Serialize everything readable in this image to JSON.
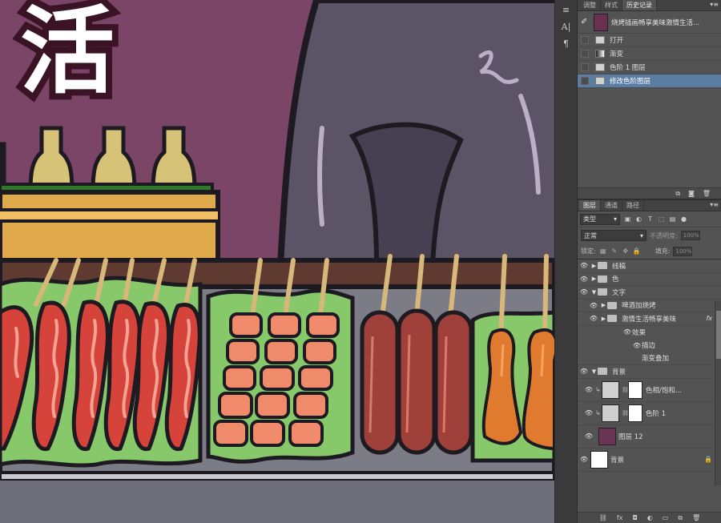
{
  "canvas": {
    "headline_char": "活"
  },
  "mini_strip": {
    "text_tool_glyph": "A|",
    "paragraph_glyph": "¶"
  },
  "history_panel": {
    "tabs": [
      "调整",
      "样式",
      "历史记录"
    ],
    "active_tab": "历史记录",
    "snapshot_title": "烧烤插画畅享美味激情生活...",
    "steps": [
      "打开",
      "渐变",
      "色阶 1 图层",
      "修改色阶图层"
    ],
    "selected_step": "修改色阶图层"
  },
  "layers_panel": {
    "tabs": [
      "图层",
      "通道",
      "路径"
    ],
    "active_tab": "图层",
    "filter_kind": "类型",
    "blend_mode": "正常",
    "opacity_label": "不透明度:",
    "opacity_value": "100%",
    "lock_label": "锁定:",
    "fill_label": "填充:",
    "fill_value": "100%",
    "layers": [
      {
        "name": "线稿",
        "type": "group",
        "indent": 0,
        "expanded": false
      },
      {
        "name": "色",
        "type": "group",
        "indent": 0,
        "expanded": false
      },
      {
        "name": "文字",
        "type": "group",
        "indent": 0,
        "expanded": true
      },
      {
        "name": "啤酒加烧烤",
        "type": "group",
        "indent": 1,
        "expanded": false
      },
      {
        "name": "激情生活畅享美味",
        "type": "group",
        "indent": 1,
        "expanded": false,
        "fx": "fx"
      },
      {
        "name": "效果",
        "type": "effect-header",
        "indent": 2
      },
      {
        "name": "描边",
        "type": "effect",
        "indent": 3
      },
      {
        "name": "渐变叠加",
        "type": "effect",
        "indent": 3
      },
      {
        "name": "背景",
        "type": "group",
        "indent": 0,
        "expanded": true
      },
      {
        "name": "色相/饱和...",
        "type": "adjustment",
        "indent": 1
      },
      {
        "name": "色阶 1",
        "type": "adjustment",
        "indent": 1
      },
      {
        "name": "图层 12",
        "type": "pixel",
        "indent": 1
      },
      {
        "name": "背景",
        "type": "background",
        "indent": 0
      }
    ],
    "colors": {
      "layer12_thumb": "#6a3555",
      "selection": "#5b7da4"
    }
  }
}
